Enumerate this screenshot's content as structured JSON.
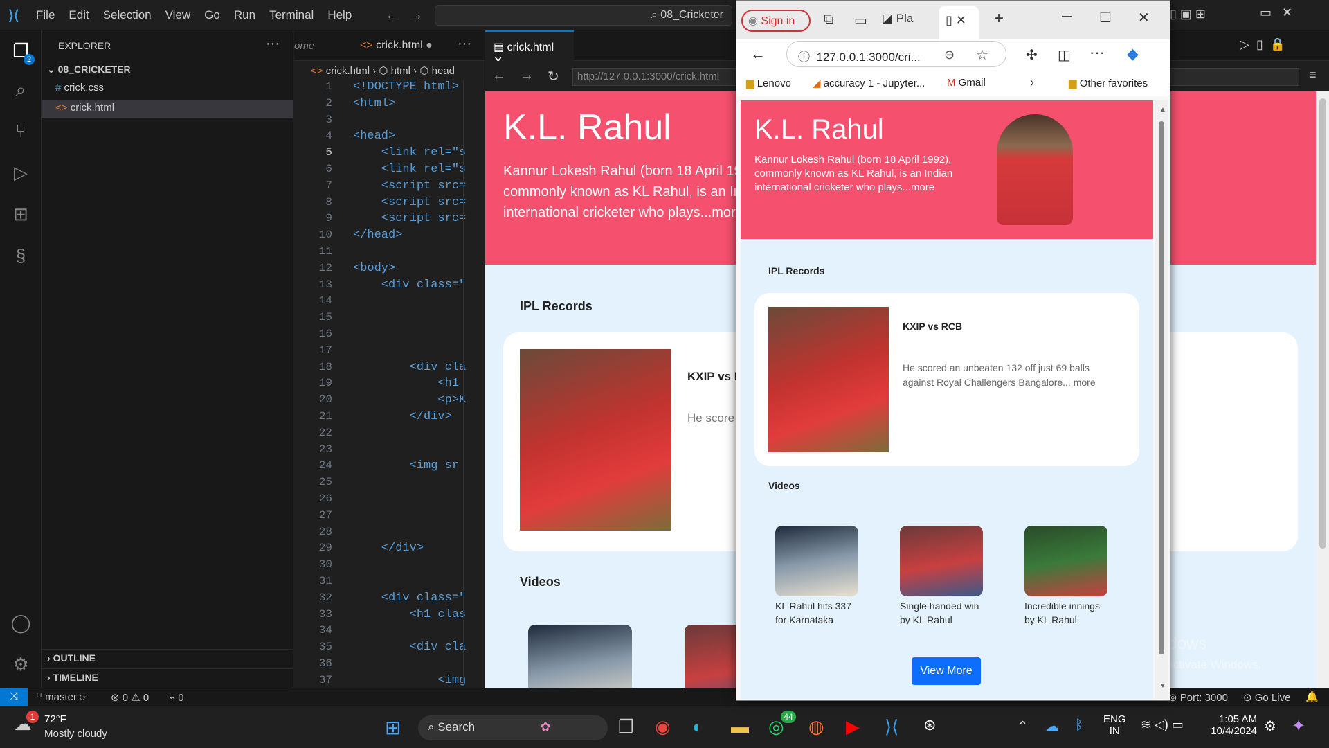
{
  "vscode": {
    "menu": [
      "File",
      "Edit",
      "Selection",
      "View",
      "Go",
      "Run",
      "Terminal",
      "Help"
    ],
    "search_text": "08_Cricketer",
    "explorer_title": "EXPLORER",
    "folder": "08_CRICKETER",
    "files": [
      "crick.css",
      "crick.html"
    ],
    "outline": "OUTLINE",
    "timeline": "TIMELINE",
    "tabs": [
      "ome",
      "crick.html"
    ],
    "preview_tab": "crick.html",
    "breadcrumb": [
      "crick.html",
      "html",
      "head"
    ],
    "preview_url": "http://127.0.0.1:3000/crick.html",
    "line_numbers": [
      "1",
      "2",
      "3",
      "4",
      "5",
      "6",
      "7",
      "8",
      "9",
      "10",
      "11",
      "12",
      "13",
      "14",
      "15",
      "16",
      "17",
      "18",
      "19",
      "20",
      "21",
      "22",
      "23",
      "24",
      "25",
      "26",
      "27",
      "28",
      "29",
      "30",
      "31",
      "32",
      "33",
      "34",
      "35",
      "36",
      "37"
    ],
    "code_lines": [
      "<!DOCTYPE html>",
      "<html>",
      "",
      "<head>",
      "    <link rel=\"s",
      "    <link rel=\"s",
      "    <script src=",
      "    <script src=",
      "    <script src=",
      "</head>",
      "",
      "<body>",
      "    <div class=\"",
      "",
      "",
      "",
      "",
      "        <div cla",
      "            <h1",
      "            <p>K",
      "        </div>",
      "",
      "",
      "        <img sr",
      "",
      "",
      "",
      "",
      "    </div>",
      "",
      "",
      "    <div class=\"",
      "        <h1 clas",
      "",
      "        <div cla",
      "",
      "            <img"
    ],
    "activity_badge": "2",
    "status": {
      "branch": "master",
      "errors": "0",
      "warnings": "0",
      "ports": "0",
      "port_label": "Port: 3000",
      "go_live": "Go Live"
    }
  },
  "preview_page": {
    "name": "K.L. Rahul",
    "bio": "Kannur Lokesh Rahul (born 18 April 19",
    "bio2": "commonly known as KL Rahul, is an In",
    "bio3": "international cricketer who plays...mor",
    "ipl_title": "IPL Records",
    "match": "KXIP vs R",
    "desc": "He score",
    "videos_title": "Videos"
  },
  "browser": {
    "signin": "Sign in",
    "tab1": "Pla",
    "url": "127.0.0.1:3000/cri...",
    "bookmarks": [
      "Lenovo",
      "accuracy 1 - Jupyter...",
      "Gmail"
    ],
    "other_favorites": "Other favorites",
    "page": {
      "name": "K.L. Rahul",
      "bio": "Kannur Lokesh Rahul (born 18 April 1992), commonly known as KL Rahul, is an Indian international cricketer who plays...more",
      "ipl_title": "IPL Records",
      "match_title": "KXIP vs RCB",
      "match_desc": "He scored an unbeaten 132 off just 69 balls against Royal Challengers Bangalore... more",
      "videos_title": "Videos",
      "videos": [
        {
          "caption": "KL Rahul hits 337 for Karnataka"
        },
        {
          "caption": "Single handed win by KL Rahul"
        },
        {
          "caption": "Incredible innings by KL Rahul"
        }
      ],
      "view_more": "View More"
    }
  },
  "watermark": {
    "line1": "Activate Windows",
    "line2": "Go to Settings to activate Windows."
  },
  "taskbar": {
    "temp": "72°F",
    "weather": "Mostly cloudy",
    "weather_badge": "1",
    "search": "Search",
    "whatsapp_badge": "44",
    "lang1": "ENG",
    "lang2": "IN",
    "time": "1:05 AM",
    "date": "10/4/2024"
  },
  "colors": {
    "accent": "#f5506e",
    "vscode_blue": "#0078d4",
    "page_bg": "#e3f2fc",
    "button": "#0d6efd"
  }
}
